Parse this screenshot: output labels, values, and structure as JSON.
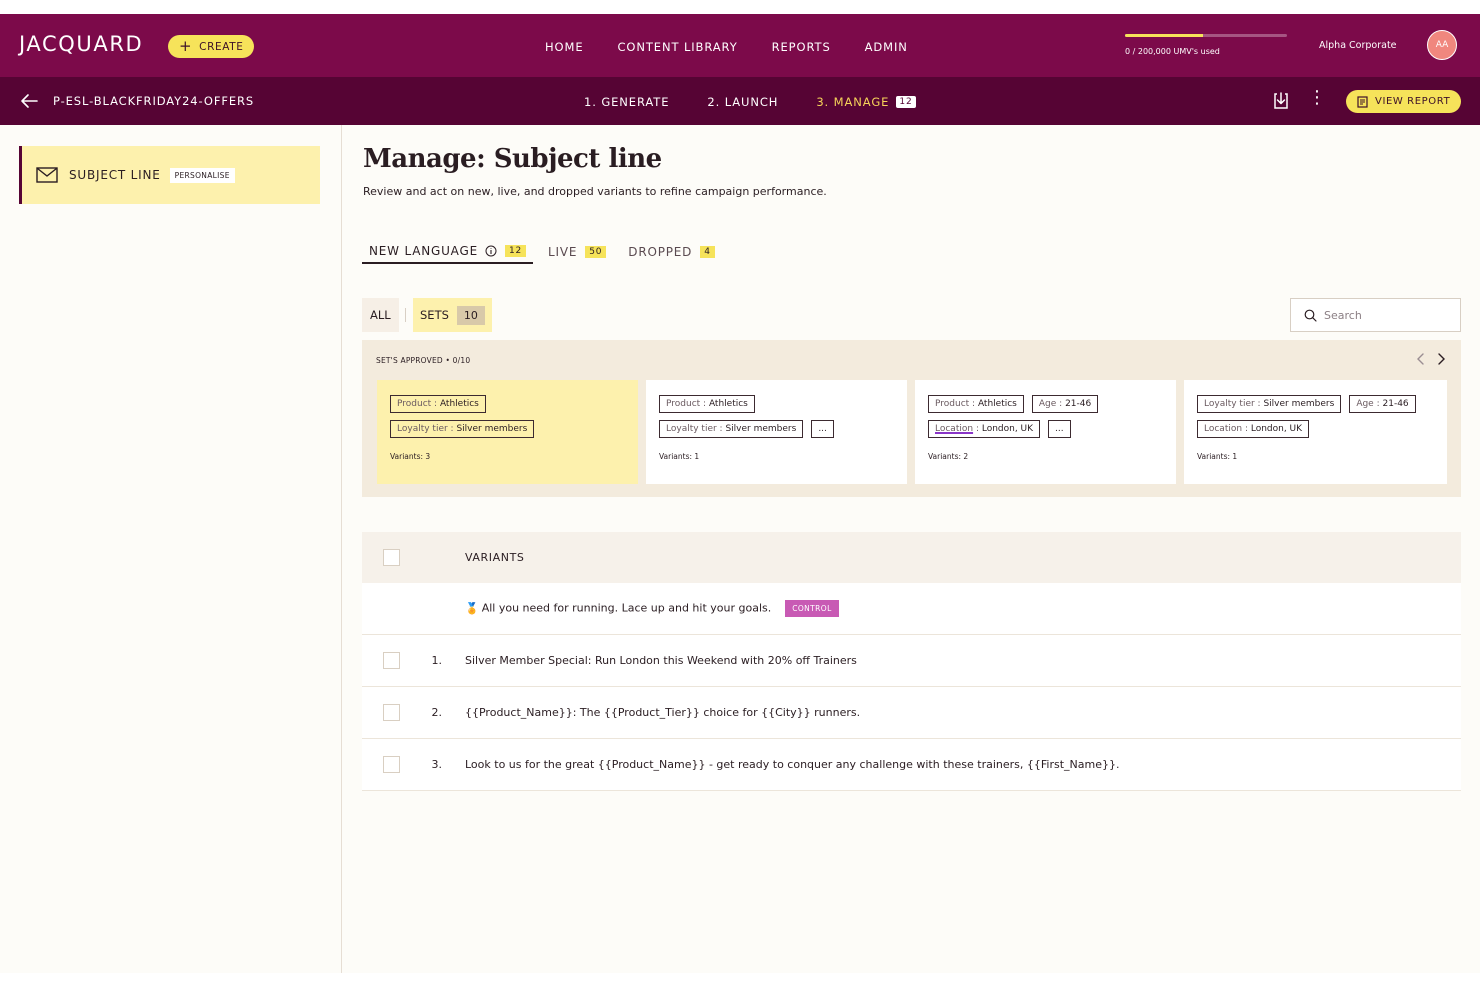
{
  "header": {
    "logo": "JACQUARD",
    "create_label": "CREATE",
    "nav": [
      "HOME",
      "CONTENT LIBRARY",
      "REPORTS",
      "ADMIN"
    ],
    "umv": {
      "text": "0 / 200,000 UMV's used",
      "progress_fraction": 0.48
    },
    "organization": "Alpha Corporate",
    "avatar_initials": "AA"
  },
  "subheader": {
    "campaign": "P-ESL-BLACKFRIDAY24-OFFERS",
    "steps": [
      {
        "label": "1. GENERATE"
      },
      {
        "label": "2. LAUNCH"
      },
      {
        "label": "3. MANAGE",
        "badge": "12",
        "active": true
      }
    ],
    "view_report_label": "VIEW REPORT"
  },
  "sidebar": {
    "item_label": "SUBJECT LINE",
    "item_tag": "PERSONALISE"
  },
  "main": {
    "title": "Manage: Subject line",
    "subtitle": "Review and act on new, live, and dropped variants to refine campaign performance.",
    "tabs": [
      {
        "label": "NEW LANGUAGE",
        "count": "12",
        "active": true
      },
      {
        "label": "LIVE",
        "count": "50"
      },
      {
        "label": "DROPPED",
        "count": "4"
      }
    ],
    "filter_all": "ALL",
    "filter_sets": "SETS",
    "filter_sets_count": "10",
    "search_placeholder": "Search"
  },
  "sets": {
    "approved_label": "SET'S APPROVED • 0/10",
    "cards": [
      {
        "rows": [
          [
            {
              "key": "Product",
              "value": "Athletics"
            }
          ],
          [
            {
              "key": "Loyalty tier",
              "value": "Silver members"
            }
          ]
        ],
        "variants": "Variants: 3"
      },
      {
        "rows": [
          [
            {
              "key": "Product",
              "value": "Athletics"
            }
          ],
          [
            {
              "key": "Loyalty tier",
              "value": "Silver members"
            },
            {
              "more": "..."
            }
          ]
        ],
        "variants": "Variants: 1"
      },
      {
        "rows": [
          [
            {
              "key": "Product",
              "value": "Athletics"
            },
            {
              "key": "Age",
              "value": "21-46"
            }
          ],
          [
            {
              "key": "Location",
              "value": "London, UK"
            },
            {
              "more": "..."
            }
          ]
        ],
        "variants": "Variants: 2"
      },
      {
        "rows": [
          [
            {
              "key": "Loyalty tier",
              "value": "Silver members"
            },
            {
              "key": "Age",
              "value": "21-46"
            }
          ],
          [
            {
              "key": "Location",
              "value": "London, UK"
            }
          ]
        ],
        "variants": "Variants: 1"
      }
    ]
  },
  "variants_table": {
    "header": "VARIANTS",
    "control": {
      "text": "All you need for running. Lace up and hit your goals.",
      "badge": "CONTROL"
    },
    "rows": [
      {
        "num": "1.",
        "text": "Silver Member Special: Run London this Weekend with 20% off Trainers"
      },
      {
        "num": "2.",
        "text": "{{Product_Name}}: The {{Product_Tier}} choice for {{City}} runners."
      },
      {
        "num": "3.",
        "text": "Look to us for the great {{Product_Name}} - get ready to conquer any challenge with these trainers, {{First_Name}}."
      }
    ]
  },
  "colors": {
    "brand_primary": "#7c0a4a",
    "brand_dark": "#560434",
    "accent_yellow": "#f6e35a",
    "selected_bg": "#fdf1ad",
    "control_badge": "#c85ab4",
    "avatar": "#f0877e"
  }
}
